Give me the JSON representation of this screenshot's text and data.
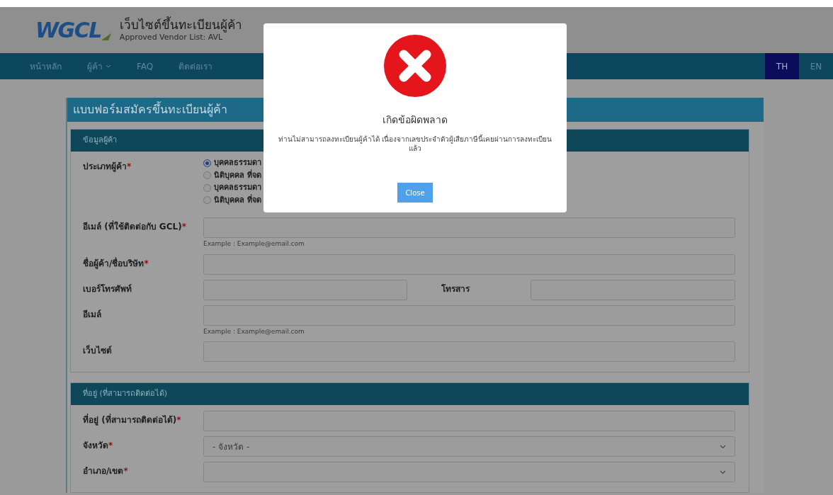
{
  "header": {
    "logo": "WGCL",
    "title": "เว็บไซต์ขึ้นทะเบียนผู้ค้า",
    "subtitle": "Approved Vendor List: AVL"
  },
  "nav": {
    "items": [
      {
        "label": "หน้าหลัก",
        "kind": "link"
      },
      {
        "label": "ผู้ค้า",
        "kind": "dropdown"
      },
      {
        "label": "FAQ",
        "kind": "link"
      },
      {
        "label": "ติดต่อเรา",
        "kind": "link"
      }
    ],
    "languages": [
      {
        "label": "TH",
        "selected": true
      },
      {
        "label": "EN",
        "selected": false
      }
    ]
  },
  "form": {
    "title": "แบบฟอร์มสมัครขึ้นทะเบียนผู้ค้า",
    "sections": [
      {
        "title": "ข้อมูลผู้ค้า",
        "fields": [
          {
            "kind": "radio",
            "label": "ประเภทผู้ค้า",
            "required_mark": "*",
            "options": [
              {
                "label": "บุคคลธรรมดา",
                "selected": true
              },
              {
                "label": "นิติบุคคล ที่จด",
                "selected": false
              },
              {
                "label": "บุคคลธรรมดา",
                "selected": false
              },
              {
                "label": "นิติบุคคล ที่จด",
                "selected": false
              }
            ]
          },
          {
            "kind": "text",
            "label": "อีเมล์ (ที่ใช้ติดต่อกับ GCL)",
            "required_mark": "*",
            "hint": "Example : Example@email.com"
          },
          {
            "kind": "text",
            "label": "ชื่อผู้ค้า/ชื่อบริษัท",
            "required_mark": "*"
          },
          {
            "kind": "pair",
            "label": "เบอร์โทรศัพท์",
            "second_label": "โทรสาร"
          },
          {
            "kind": "text",
            "label": "อีเมล์",
            "hint": "Example : Example@email.com"
          },
          {
            "kind": "text",
            "label": "เว็บไซต์"
          }
        ]
      },
      {
        "title": "ที่อยู่ (ที่สามารถติดต่อได้)",
        "fields": [
          {
            "kind": "text",
            "label": "ที่อยู่ (ที่สามารถติดต่อได้)",
            "required_mark": "*"
          },
          {
            "kind": "select",
            "label": "จังหวัด",
            "required_mark": "*",
            "placeholder": "- จังหวัด -"
          },
          {
            "kind": "select",
            "label": "อำเภอ/เขต",
            "required_mark": "*"
          }
        ]
      }
    ]
  },
  "dialog": {
    "title": "เกิดข้อผิดพลาด",
    "message": "ท่านไม่สามารถลงทะเบียนผู้ค้าได้ เนื่องจากเลขประจำตัวผู้เสียภาษีนี้เคยผ่านการลงทะเบียนแล้ว",
    "button": "Close"
  }
}
